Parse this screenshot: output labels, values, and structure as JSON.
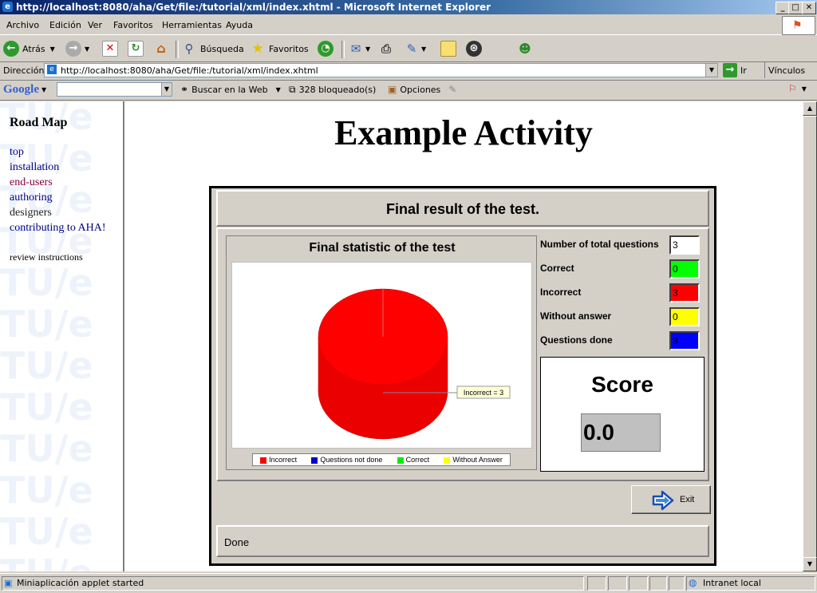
{
  "window": {
    "title": "http://localhost:8080/aha/Get/file:/tutorial/xml/index.xhtml - Microsoft Internet Explorer",
    "minimize": "_",
    "maximize": "□",
    "close": "✕"
  },
  "menu": [
    "Archivo",
    "Edición",
    "Ver",
    "Favoritos",
    "Herramientas",
    "Ayuda"
  ],
  "toolbar": {
    "back": "Atrás",
    "search": "Búsqueda",
    "favorites": "Favoritos"
  },
  "address": {
    "label": "Dirección",
    "url": "http://localhost:8080/aha/Get/file:/tutorial/xml/index.xhtml",
    "go": "Ir",
    "links": "Vínculos"
  },
  "google": {
    "logo": "Google",
    "search_web": "Buscar en la Web",
    "blocked": "328 bloqueado(s)",
    "options": "Opciones"
  },
  "sidebar": {
    "title": "Road Map",
    "links": [
      {
        "label": "top",
        "color": "#000080"
      },
      {
        "label": "installation",
        "color": "#000080"
      },
      {
        "label": "end-users",
        "color": "#800040"
      },
      {
        "label": "authoring",
        "color": "#000080"
      },
      {
        "label": "designers",
        "color": "#202020"
      },
      {
        "label": "contributing to AHA!",
        "color": "#000080"
      }
    ],
    "review": "review instructions",
    "watermark": "TU/e"
  },
  "page": {
    "title": "Example Activity"
  },
  "applet": {
    "header": "Final result of the test.",
    "chart_title": "Final statistic of the test",
    "stats": [
      {
        "label": "Number of total questions",
        "value": "3",
        "color": "#ffffff"
      },
      {
        "label": "Correct",
        "value": "0",
        "color": "#00ff00"
      },
      {
        "label": "Incorrect",
        "value": "3",
        "color": "#ff0000"
      },
      {
        "label": "Without answer",
        "value": "0",
        "color": "#ffff00"
      },
      {
        "label": "Questions done",
        "value": "3",
        "color": "#0000ff"
      }
    ],
    "score_label": "Score",
    "score_value": "0.0",
    "exit": "Exit",
    "status": "Done"
  },
  "chart_data": {
    "type": "pie",
    "title": "Final statistic of the test",
    "categories": [
      "Incorrect",
      "Questions not done",
      "Correct",
      "Without Answer"
    ],
    "values": [
      3,
      0,
      0,
      0
    ],
    "colors": [
      "#ff0000",
      "#0000cc",
      "#00ee00",
      "#ffff00"
    ],
    "annotation": "Incorrect = 3",
    "legend_position": "bottom"
  },
  "statusbar": {
    "text": "Miniaplicación applet started",
    "zone": "Intranet local"
  }
}
